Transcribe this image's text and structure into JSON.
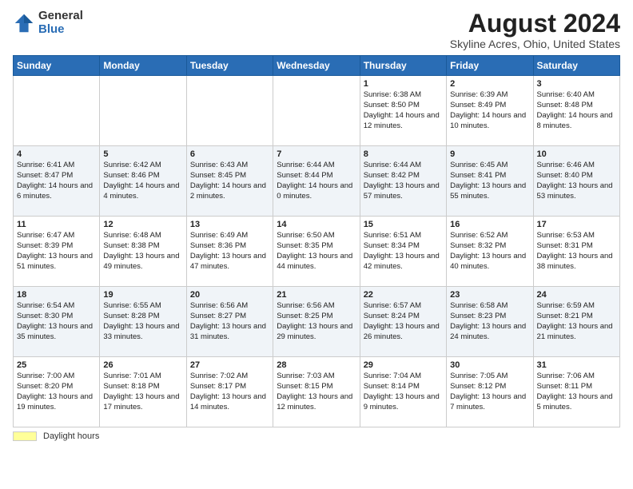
{
  "logo": {
    "general": "General",
    "blue": "Blue"
  },
  "title": "August 2024",
  "subtitle": "Skyline Acres, Ohio, United States",
  "days_of_week": [
    "Sunday",
    "Monday",
    "Tuesday",
    "Wednesday",
    "Thursday",
    "Friday",
    "Saturday"
  ],
  "weeks": [
    [
      {
        "day": "",
        "info": ""
      },
      {
        "day": "",
        "info": ""
      },
      {
        "day": "",
        "info": ""
      },
      {
        "day": "",
        "info": ""
      },
      {
        "day": "1",
        "info": "Sunrise: 6:38 AM\nSunset: 8:50 PM\nDaylight: 14 hours and 12 minutes."
      },
      {
        "day": "2",
        "info": "Sunrise: 6:39 AM\nSunset: 8:49 PM\nDaylight: 14 hours and 10 minutes."
      },
      {
        "day": "3",
        "info": "Sunrise: 6:40 AM\nSunset: 8:48 PM\nDaylight: 14 hours and 8 minutes."
      }
    ],
    [
      {
        "day": "4",
        "info": "Sunrise: 6:41 AM\nSunset: 8:47 PM\nDaylight: 14 hours and 6 minutes."
      },
      {
        "day": "5",
        "info": "Sunrise: 6:42 AM\nSunset: 8:46 PM\nDaylight: 14 hours and 4 minutes."
      },
      {
        "day": "6",
        "info": "Sunrise: 6:43 AM\nSunset: 8:45 PM\nDaylight: 14 hours and 2 minutes."
      },
      {
        "day": "7",
        "info": "Sunrise: 6:44 AM\nSunset: 8:44 PM\nDaylight: 14 hours and 0 minutes."
      },
      {
        "day": "8",
        "info": "Sunrise: 6:44 AM\nSunset: 8:42 PM\nDaylight: 13 hours and 57 minutes."
      },
      {
        "day": "9",
        "info": "Sunrise: 6:45 AM\nSunset: 8:41 PM\nDaylight: 13 hours and 55 minutes."
      },
      {
        "day": "10",
        "info": "Sunrise: 6:46 AM\nSunset: 8:40 PM\nDaylight: 13 hours and 53 minutes."
      }
    ],
    [
      {
        "day": "11",
        "info": "Sunrise: 6:47 AM\nSunset: 8:39 PM\nDaylight: 13 hours and 51 minutes."
      },
      {
        "day": "12",
        "info": "Sunrise: 6:48 AM\nSunset: 8:38 PM\nDaylight: 13 hours and 49 minutes."
      },
      {
        "day": "13",
        "info": "Sunrise: 6:49 AM\nSunset: 8:36 PM\nDaylight: 13 hours and 47 minutes."
      },
      {
        "day": "14",
        "info": "Sunrise: 6:50 AM\nSunset: 8:35 PM\nDaylight: 13 hours and 44 minutes."
      },
      {
        "day": "15",
        "info": "Sunrise: 6:51 AM\nSunset: 8:34 PM\nDaylight: 13 hours and 42 minutes."
      },
      {
        "day": "16",
        "info": "Sunrise: 6:52 AM\nSunset: 8:32 PM\nDaylight: 13 hours and 40 minutes."
      },
      {
        "day": "17",
        "info": "Sunrise: 6:53 AM\nSunset: 8:31 PM\nDaylight: 13 hours and 38 minutes."
      }
    ],
    [
      {
        "day": "18",
        "info": "Sunrise: 6:54 AM\nSunset: 8:30 PM\nDaylight: 13 hours and 35 minutes."
      },
      {
        "day": "19",
        "info": "Sunrise: 6:55 AM\nSunset: 8:28 PM\nDaylight: 13 hours and 33 minutes."
      },
      {
        "day": "20",
        "info": "Sunrise: 6:56 AM\nSunset: 8:27 PM\nDaylight: 13 hours and 31 minutes."
      },
      {
        "day": "21",
        "info": "Sunrise: 6:56 AM\nSunset: 8:25 PM\nDaylight: 13 hours and 29 minutes."
      },
      {
        "day": "22",
        "info": "Sunrise: 6:57 AM\nSunset: 8:24 PM\nDaylight: 13 hours and 26 minutes."
      },
      {
        "day": "23",
        "info": "Sunrise: 6:58 AM\nSunset: 8:23 PM\nDaylight: 13 hours and 24 minutes."
      },
      {
        "day": "24",
        "info": "Sunrise: 6:59 AM\nSunset: 8:21 PM\nDaylight: 13 hours and 21 minutes."
      }
    ],
    [
      {
        "day": "25",
        "info": "Sunrise: 7:00 AM\nSunset: 8:20 PM\nDaylight: 13 hours and 19 minutes."
      },
      {
        "day": "26",
        "info": "Sunrise: 7:01 AM\nSunset: 8:18 PM\nDaylight: 13 hours and 17 minutes."
      },
      {
        "day": "27",
        "info": "Sunrise: 7:02 AM\nSunset: 8:17 PM\nDaylight: 13 hours and 14 minutes."
      },
      {
        "day": "28",
        "info": "Sunrise: 7:03 AM\nSunset: 8:15 PM\nDaylight: 13 hours and 12 minutes."
      },
      {
        "day": "29",
        "info": "Sunrise: 7:04 AM\nSunset: 8:14 PM\nDaylight: 13 hours and 9 minutes."
      },
      {
        "day": "30",
        "info": "Sunrise: 7:05 AM\nSunset: 8:12 PM\nDaylight: 13 hours and 7 minutes."
      },
      {
        "day": "31",
        "info": "Sunrise: 7:06 AM\nSunset: 8:11 PM\nDaylight: 13 hours and 5 minutes."
      }
    ]
  ],
  "footer": {
    "legend_label": "Daylight hours"
  }
}
